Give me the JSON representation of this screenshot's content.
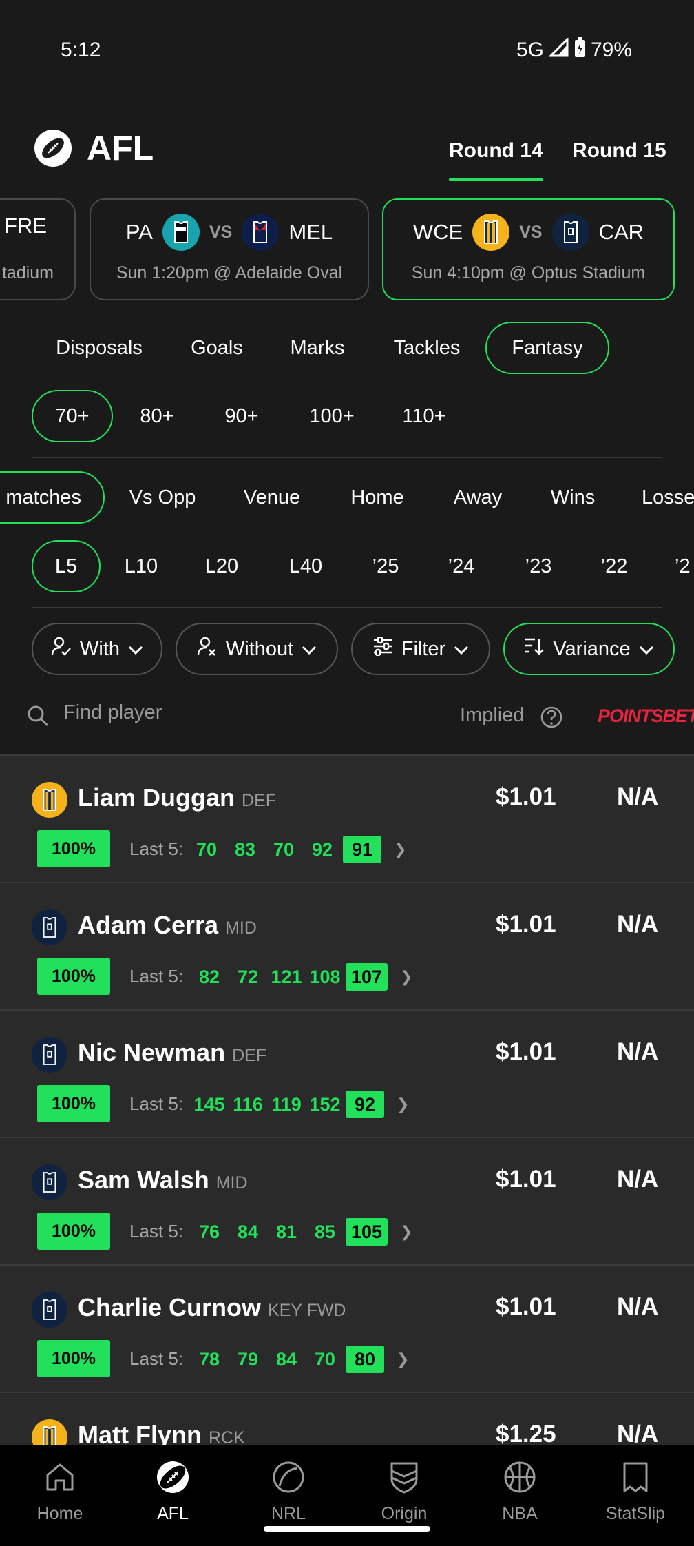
{
  "status": {
    "time": "5:12",
    "network": "5G",
    "battery": "79%"
  },
  "header": {
    "title": "AFL",
    "rounds": [
      {
        "label": "Round 14",
        "active": true
      },
      {
        "label": "Round 15",
        "active": false
      }
    ]
  },
  "matches": [
    {
      "home": "FRE",
      "away": "",
      "sub": "tadium",
      "selected": false
    },
    {
      "home": "PA",
      "away": "MEL",
      "vs": "VS",
      "sub": "Sun 1:20pm @ Adelaide Oval",
      "selected": false
    },
    {
      "home": "WCE",
      "away": "CAR",
      "vs": "VS",
      "sub": "Sun 4:10pm @ Optus Stadium",
      "selected": true
    }
  ],
  "stat_tabs": [
    "Disposals",
    "Goals",
    "Marks",
    "Tackles",
    "Fantasy"
  ],
  "thresholds": [
    "70+",
    "80+",
    "90+",
    "100+",
    "110+"
  ],
  "splits": [
    "matches",
    "Vs Opp",
    "Venue",
    "Home",
    "Away",
    "Wins",
    "Losse"
  ],
  "periods": [
    "L5",
    "L10",
    "L20",
    "L40",
    "’25",
    "’24",
    "’23",
    "’22",
    "’2"
  ],
  "filters": {
    "with": "With",
    "without": "Without",
    "filter": "Filter",
    "variance": "Variance"
  },
  "search": {
    "placeholder": "Find player",
    "implied": "Implied",
    "bookie": "POINTSBET"
  },
  "colors": {
    "accent": "#22e05a",
    "wce_gold": "#f6b21a",
    "car_navy": "#0f2340",
    "pa_teal": "#19a3ad",
    "mel_navy": "#0e1e4a",
    "bookie_red": "#e5253f"
  },
  "players": [
    {
      "name": "Liam Duggan",
      "pos": "DEF",
      "team": "WCE",
      "odds": "$1.01",
      "alt": "N/A",
      "pct": "100%",
      "last5_label": "Last 5:",
      "last5": [
        "70",
        "83",
        "70",
        "92"
      ],
      "latest": "91"
    },
    {
      "name": "Adam Cerra",
      "pos": "MID",
      "team": "CAR",
      "odds": "$1.01",
      "alt": "N/A",
      "pct": "100%",
      "last5_label": "Last 5:",
      "last5": [
        "82",
        "72",
        "121",
        "108"
      ],
      "latest": "107"
    },
    {
      "name": "Nic Newman",
      "pos": "DEF",
      "team": "CAR",
      "odds": "$1.01",
      "alt": "N/A",
      "pct": "100%",
      "last5_label": "Last 5:",
      "last5": [
        "145",
        "116",
        "119",
        "152"
      ],
      "latest": "92"
    },
    {
      "name": "Sam Walsh",
      "pos": "MID",
      "team": "CAR",
      "odds": "$1.01",
      "alt": "N/A",
      "pct": "100%",
      "last5_label": "Last 5:",
      "last5": [
        "76",
        "84",
        "81",
        "85"
      ],
      "latest": "105"
    },
    {
      "name": "Charlie Curnow",
      "pos": "KEY FWD",
      "team": "CAR",
      "odds": "$1.01",
      "alt": "N/A",
      "pct": "100%",
      "last5_label": "Last 5:",
      "last5": [
        "78",
        "79",
        "84",
        "70"
      ],
      "latest": "80"
    },
    {
      "name": "Matt Flynn",
      "pos": "RCK",
      "team": "WCE",
      "odds": "$1.25",
      "alt": "N/A"
    }
  ],
  "nav": [
    {
      "label": "Home",
      "icon": "home-icon"
    },
    {
      "label": "AFL",
      "icon": "afl-football-icon",
      "active": true
    },
    {
      "label": "NRL",
      "icon": "nrl-ball-icon"
    },
    {
      "label": "Origin",
      "icon": "origin-shield-icon"
    },
    {
      "label": "NBA",
      "icon": "basketball-icon"
    },
    {
      "label": "StatSlip",
      "icon": "statslip-icon"
    }
  ]
}
